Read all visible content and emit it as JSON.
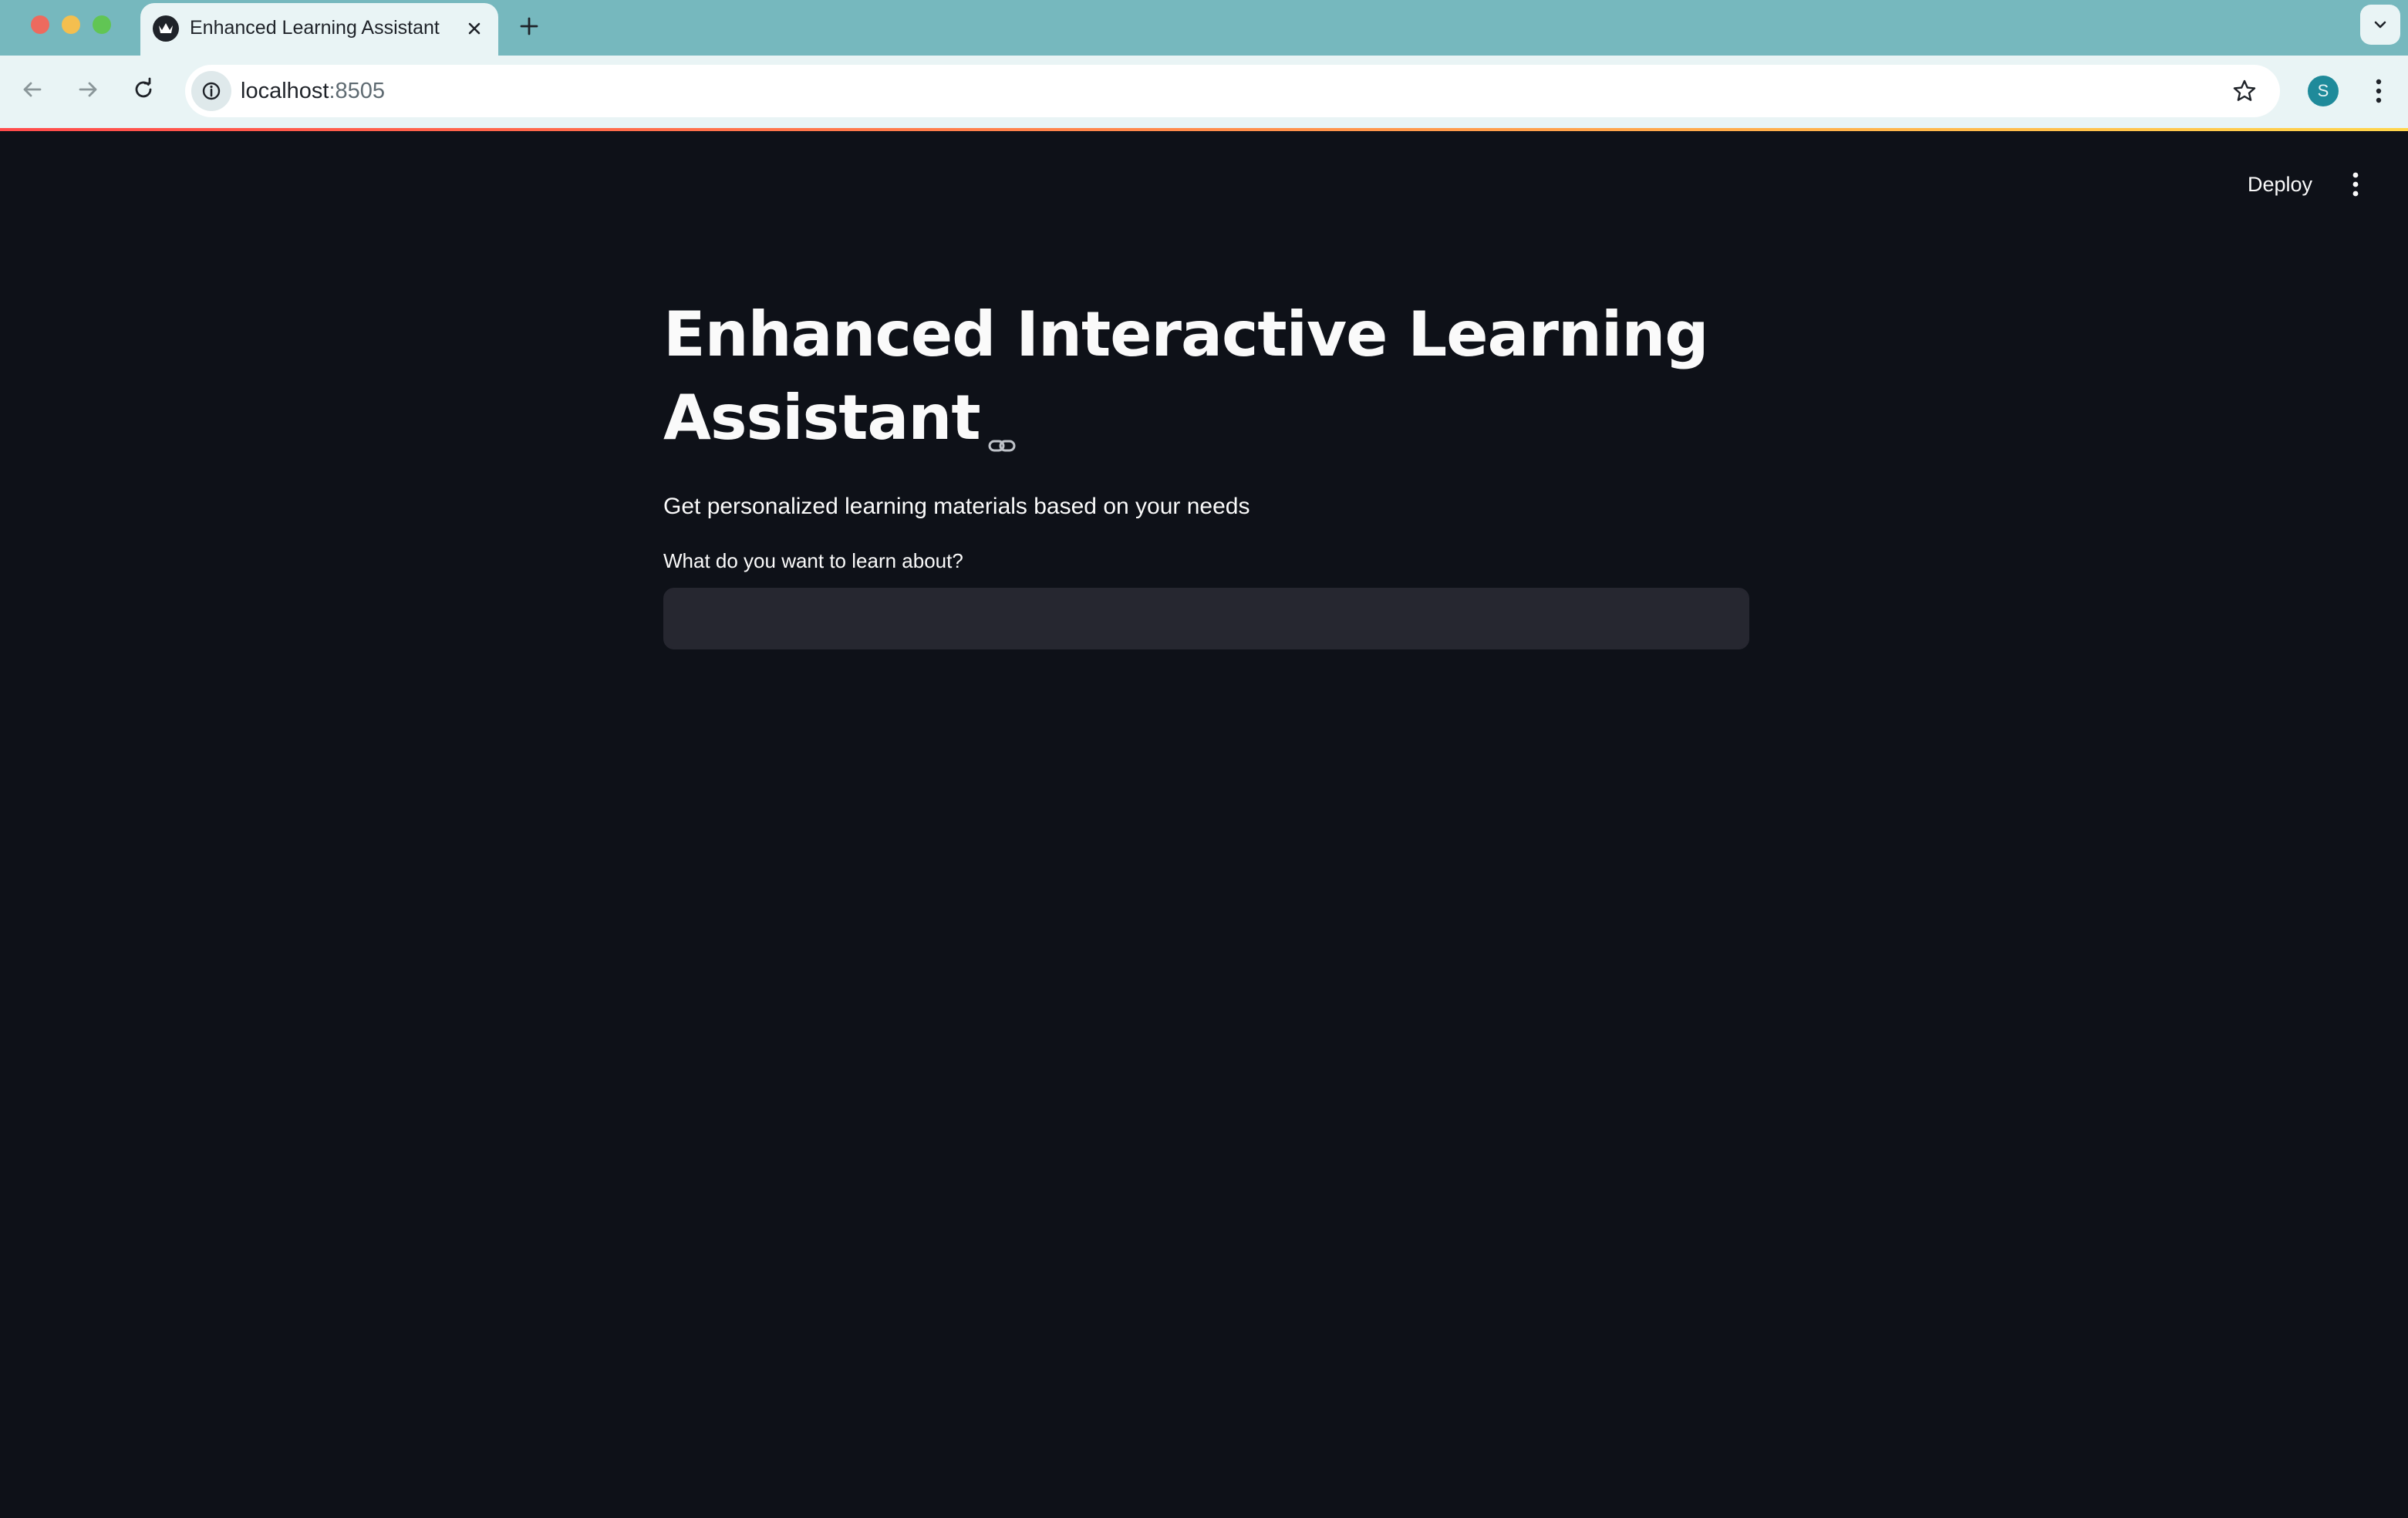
{
  "browser": {
    "tab_title": "Enhanced Learning Assistant",
    "url_host": "localhost",
    "url_port": ":8505",
    "profile_initial": "S",
    "icons": {
      "favicon": "streamlit-crown-icon",
      "close": "close-icon",
      "new_tab": "plus-icon",
      "tab_list": "chevron-down-icon",
      "back": "arrow-left-icon",
      "forward": "arrow-right-icon",
      "reload": "reload-icon",
      "site_info": "info-icon",
      "bookmark": "star-icon",
      "menu": "kebab-menu-icon"
    }
  },
  "app": {
    "deploy_label": "Deploy",
    "title": "Enhanced Interactive Learning Assistant",
    "subtitle": "Get personalized learning materials based on your needs",
    "topic_input": {
      "label": "What do you want to learn about?",
      "value": "",
      "placeholder": ""
    }
  },
  "colors": {
    "tabstrip": "#76b8be",
    "toolbar": "#e9f4f5",
    "page_background": "#0e1118",
    "input_background": "#262730",
    "text": "#fafafa",
    "accent_gradient": [
      "#ff4b4b",
      "#ffd54b"
    ]
  }
}
